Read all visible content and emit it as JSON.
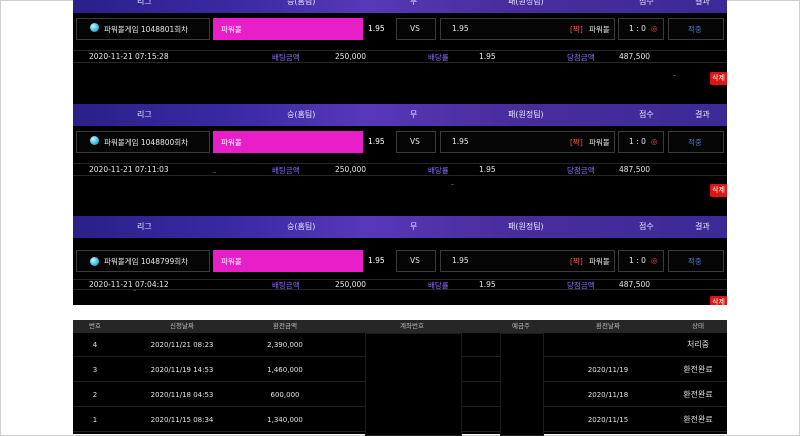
{
  "header": {
    "league": "리그",
    "win": "승(홈팀)",
    "draw": "무",
    "lose": "패(원정팀)",
    "score": "점수",
    "result": "결과"
  },
  "bets": [
    {
      "game": "파워볼게임 1048801회차",
      "home": "파워볼",
      "home_odds": "1.95",
      "vs": "VS",
      "away_odds": "1.95",
      "away_tag": "[짝]",
      "away": "파워볼",
      "score": "1 : 0",
      "score_icon": "◎",
      "result": "적중",
      "datetime": "2020-11-21 07:15:28",
      "bet_label": "배팅금액",
      "bet_amount": "250,000",
      "odds_label": "배당률",
      "odds": "1.95",
      "win_label": "당첨금액",
      "win_amount": "487,500",
      "delete": "삭제"
    },
    {
      "game": "파워볼게임 1048800회차",
      "home": "파워볼",
      "home_odds": "1.95",
      "vs": "VS",
      "away_odds": "1.95",
      "away_tag": "[짝]",
      "away": "파워볼",
      "score": "1 : 0",
      "score_icon": "◎",
      "result": "적중",
      "datetime": "2020-11-21 07:11:03",
      "bet_label": "배팅금액",
      "bet_amount": "250,000",
      "odds_label": "배당률",
      "odds": "1.95",
      "win_label": "당첨금액",
      "win_amount": "487,500",
      "delete": "삭제"
    },
    {
      "game": "파워볼게임 1048799회차",
      "home": "파워볼",
      "home_odds": "1.95",
      "vs": "VS",
      "away_odds": "1.95",
      "away_tag": "[짝]",
      "away": "파워볼",
      "score": "1 : 0",
      "score_icon": "◎",
      "result": "적중",
      "datetime": "2020-11-21 07:04:12",
      "bet_label": "배팅금액",
      "bet_amount": "250,000",
      "odds_label": "배당률",
      "odds": "1.95",
      "win_label": "당첨금액",
      "win_amount": "487,500",
      "delete": "삭제"
    }
  ],
  "exchange": {
    "columns": [
      "번호",
      "신청날짜",
      "환전금액",
      "계좌번호",
      "예금주",
      "환전날짜",
      "상태"
    ],
    "rows": [
      {
        "no": "4",
        "req_date": "2020/11/21 08:23",
        "amount": "2,390,000",
        "done_date": "",
        "status": "처리중"
      },
      {
        "no": "3",
        "req_date": "2020/11/19 14:53",
        "amount": "1,460,000",
        "done_date": "2020/11/19",
        "status": "환전완료"
      },
      {
        "no": "2",
        "req_date": "2020/11/18 04:53",
        "amount": "600,000",
        "done_date": "2020/11/18",
        "status": "환전완료"
      },
      {
        "no": "1",
        "req_date": "2020/11/15 08:34",
        "amount": "1,340,000",
        "done_date": "2020/11/15",
        "status": "환전완료"
      }
    ]
  },
  "colors": {
    "header_gradient": "#3a2aa3",
    "pink": "#e81fc8",
    "red": "#e01414",
    "purple": "#8e6cff",
    "link_blue": "#3a7bd5"
  }
}
